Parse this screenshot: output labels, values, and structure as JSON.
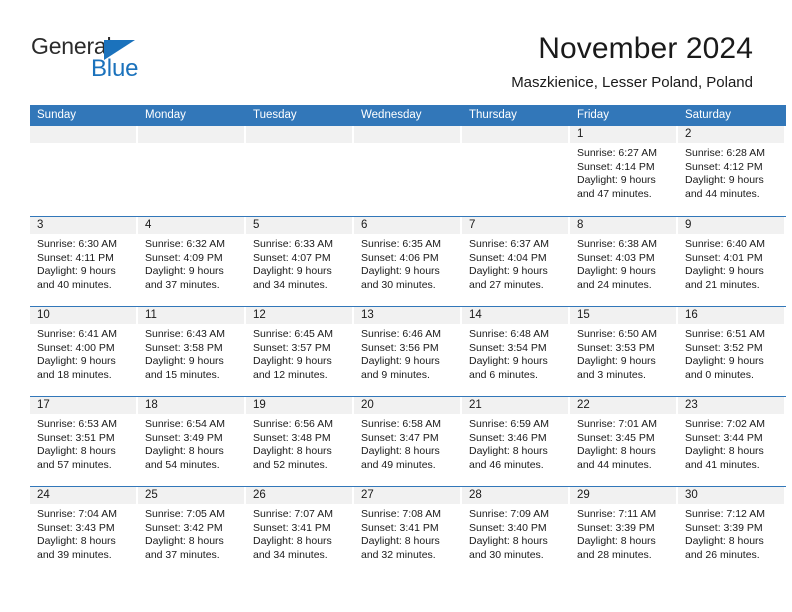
{
  "brand": {
    "name_part1": "General",
    "name_part2": "Blue",
    "triangle_color": "#1b72bc"
  },
  "header": {
    "title": "November 2024",
    "subtitle": "Maszkienice, Lesser Poland, Poland"
  },
  "colors": {
    "header_blue": "#3277b9",
    "day_band_gray": "#f1f1f1",
    "text": "#1a1a1a"
  },
  "weekdays": [
    "Sunday",
    "Monday",
    "Tuesday",
    "Wednesday",
    "Thursday",
    "Friday",
    "Saturday"
  ],
  "weeks": [
    [
      {
        "empty": true
      },
      {
        "empty": true
      },
      {
        "empty": true
      },
      {
        "empty": true
      },
      {
        "empty": true
      },
      {
        "day": "1",
        "sunrise": "Sunrise: 6:27 AM",
        "sunset": "Sunset: 4:14 PM",
        "daylight": "Daylight: 9 hours and 47 minutes."
      },
      {
        "day": "2",
        "sunrise": "Sunrise: 6:28 AM",
        "sunset": "Sunset: 4:12 PM",
        "daylight": "Daylight: 9 hours and 44 minutes."
      }
    ],
    [
      {
        "day": "3",
        "sunrise": "Sunrise: 6:30 AM",
        "sunset": "Sunset: 4:11 PM",
        "daylight": "Daylight: 9 hours and 40 minutes."
      },
      {
        "day": "4",
        "sunrise": "Sunrise: 6:32 AM",
        "sunset": "Sunset: 4:09 PM",
        "daylight": "Daylight: 9 hours and 37 minutes."
      },
      {
        "day": "5",
        "sunrise": "Sunrise: 6:33 AM",
        "sunset": "Sunset: 4:07 PM",
        "daylight": "Daylight: 9 hours and 34 minutes."
      },
      {
        "day": "6",
        "sunrise": "Sunrise: 6:35 AM",
        "sunset": "Sunset: 4:06 PM",
        "daylight": "Daylight: 9 hours and 30 minutes."
      },
      {
        "day": "7",
        "sunrise": "Sunrise: 6:37 AM",
        "sunset": "Sunset: 4:04 PM",
        "daylight": "Daylight: 9 hours and 27 minutes."
      },
      {
        "day": "8",
        "sunrise": "Sunrise: 6:38 AM",
        "sunset": "Sunset: 4:03 PM",
        "daylight": "Daylight: 9 hours and 24 minutes."
      },
      {
        "day": "9",
        "sunrise": "Sunrise: 6:40 AM",
        "sunset": "Sunset: 4:01 PM",
        "daylight": "Daylight: 9 hours and 21 minutes."
      }
    ],
    [
      {
        "day": "10",
        "sunrise": "Sunrise: 6:41 AM",
        "sunset": "Sunset: 4:00 PM",
        "daylight": "Daylight: 9 hours and 18 minutes."
      },
      {
        "day": "11",
        "sunrise": "Sunrise: 6:43 AM",
        "sunset": "Sunset: 3:58 PM",
        "daylight": "Daylight: 9 hours and 15 minutes."
      },
      {
        "day": "12",
        "sunrise": "Sunrise: 6:45 AM",
        "sunset": "Sunset: 3:57 PM",
        "daylight": "Daylight: 9 hours and 12 minutes."
      },
      {
        "day": "13",
        "sunrise": "Sunrise: 6:46 AM",
        "sunset": "Sunset: 3:56 PM",
        "daylight": "Daylight: 9 hours and 9 minutes."
      },
      {
        "day": "14",
        "sunrise": "Sunrise: 6:48 AM",
        "sunset": "Sunset: 3:54 PM",
        "daylight": "Daylight: 9 hours and 6 minutes."
      },
      {
        "day": "15",
        "sunrise": "Sunrise: 6:50 AM",
        "sunset": "Sunset: 3:53 PM",
        "daylight": "Daylight: 9 hours and 3 minutes."
      },
      {
        "day": "16",
        "sunrise": "Sunrise: 6:51 AM",
        "sunset": "Sunset: 3:52 PM",
        "daylight": "Daylight: 9 hours and 0 minutes."
      }
    ],
    [
      {
        "day": "17",
        "sunrise": "Sunrise: 6:53 AM",
        "sunset": "Sunset: 3:51 PM",
        "daylight": "Daylight: 8 hours and 57 minutes."
      },
      {
        "day": "18",
        "sunrise": "Sunrise: 6:54 AM",
        "sunset": "Sunset: 3:49 PM",
        "daylight": "Daylight: 8 hours and 54 minutes."
      },
      {
        "day": "19",
        "sunrise": "Sunrise: 6:56 AM",
        "sunset": "Sunset: 3:48 PM",
        "daylight": "Daylight: 8 hours and 52 minutes."
      },
      {
        "day": "20",
        "sunrise": "Sunrise: 6:58 AM",
        "sunset": "Sunset: 3:47 PM",
        "daylight": "Daylight: 8 hours and 49 minutes."
      },
      {
        "day": "21",
        "sunrise": "Sunrise: 6:59 AM",
        "sunset": "Sunset: 3:46 PM",
        "daylight": "Daylight: 8 hours and 46 minutes."
      },
      {
        "day": "22",
        "sunrise": "Sunrise: 7:01 AM",
        "sunset": "Sunset: 3:45 PM",
        "daylight": "Daylight: 8 hours and 44 minutes."
      },
      {
        "day": "23",
        "sunrise": "Sunrise: 7:02 AM",
        "sunset": "Sunset: 3:44 PM",
        "daylight": "Daylight: 8 hours and 41 minutes."
      }
    ],
    [
      {
        "day": "24",
        "sunrise": "Sunrise: 7:04 AM",
        "sunset": "Sunset: 3:43 PM",
        "daylight": "Daylight: 8 hours and 39 minutes."
      },
      {
        "day": "25",
        "sunrise": "Sunrise: 7:05 AM",
        "sunset": "Sunset: 3:42 PM",
        "daylight": "Daylight: 8 hours and 37 minutes."
      },
      {
        "day": "26",
        "sunrise": "Sunrise: 7:07 AM",
        "sunset": "Sunset: 3:41 PM",
        "daylight": "Daylight: 8 hours and 34 minutes."
      },
      {
        "day": "27",
        "sunrise": "Sunrise: 7:08 AM",
        "sunset": "Sunset: 3:41 PM",
        "daylight": "Daylight: 8 hours and 32 minutes."
      },
      {
        "day": "28",
        "sunrise": "Sunrise: 7:09 AM",
        "sunset": "Sunset: 3:40 PM",
        "daylight": "Daylight: 8 hours and 30 minutes."
      },
      {
        "day": "29",
        "sunrise": "Sunrise: 7:11 AM",
        "sunset": "Sunset: 3:39 PM",
        "daylight": "Daylight: 8 hours and 28 minutes."
      },
      {
        "day": "30",
        "sunrise": "Sunrise: 7:12 AM",
        "sunset": "Sunset: 3:39 PM",
        "daylight": "Daylight: 8 hours and 26 minutes."
      }
    ]
  ]
}
